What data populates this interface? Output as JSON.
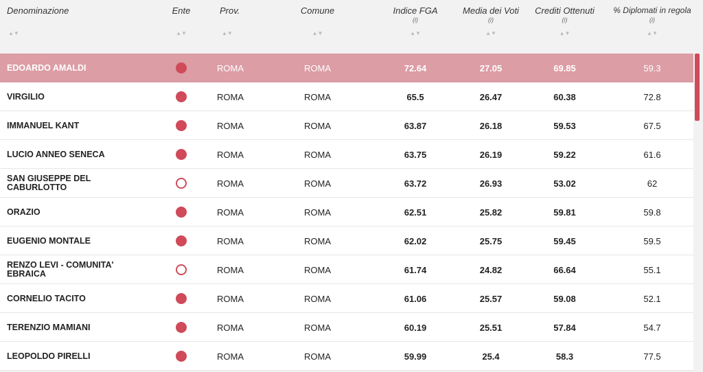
{
  "columns": {
    "denominazione": "Denominazione",
    "ente": "Ente",
    "prov": "Prov.",
    "comune": "Comune",
    "fga": "Indice FGA",
    "media": "Media dei Voti",
    "crediti": "Crediti Ottenuti",
    "diplomati": "% Diplomati in regola",
    "info_marker": "(i)",
    "sort_up": "▲",
    "sort_down": "▼"
  },
  "colors": {
    "accent": "#d04a59",
    "selected_row": "#dc9da5"
  },
  "rows": [
    {
      "name": "EDOARDO AMALDI",
      "ente": "filled",
      "prov": "ROMA",
      "comune": "ROMA",
      "fga": "72.64",
      "media": "27.05",
      "crediti": "69.85",
      "diplomati": "59.3",
      "selected": true
    },
    {
      "name": "VIRGILIO",
      "ente": "filled",
      "prov": "ROMA",
      "comune": "ROMA",
      "fga": "65.5",
      "media": "26.47",
      "crediti": "60.38",
      "diplomati": "72.8"
    },
    {
      "name": "IMMANUEL KANT",
      "ente": "filled",
      "prov": "ROMA",
      "comune": "ROMA",
      "fga": "63.87",
      "media": "26.18",
      "crediti": "59.53",
      "diplomati": "67.5"
    },
    {
      "name": "LUCIO ANNEO SENECA",
      "ente": "filled",
      "prov": "ROMA",
      "comune": "ROMA",
      "fga": "63.75",
      "media": "26.19",
      "crediti": "59.22",
      "diplomati": "61.6"
    },
    {
      "name": "SAN GIUSEPPE DEL CABURLOTTO",
      "ente": "empty",
      "prov": "ROMA",
      "comune": "ROMA",
      "fga": "63.72",
      "media": "26.93",
      "crediti": "53.02",
      "diplomati": "62"
    },
    {
      "name": "ORAZIO",
      "ente": "filled",
      "prov": "ROMA",
      "comune": "ROMA",
      "fga": "62.51",
      "media": "25.82",
      "crediti": "59.81",
      "diplomati": "59.8"
    },
    {
      "name": "EUGENIO MONTALE",
      "ente": "filled",
      "prov": "ROMA",
      "comune": "ROMA",
      "fga": "62.02",
      "media": "25.75",
      "crediti": "59.45",
      "diplomati": "59.5"
    },
    {
      "name": "RENZO LEVI - COMUNITA' EBRAICA",
      "ente": "empty",
      "prov": "ROMA",
      "comune": "ROMA",
      "fga": "61.74",
      "media": "24.82",
      "crediti": "66.64",
      "diplomati": "55.1"
    },
    {
      "name": "CORNELIO TACITO",
      "ente": "filled",
      "prov": "ROMA",
      "comune": "ROMA",
      "fga": "61.06",
      "media": "25.57",
      "crediti": "59.08",
      "diplomati": "52.1"
    },
    {
      "name": "TERENZIO MAMIANI",
      "ente": "filled",
      "prov": "ROMA",
      "comune": "ROMA",
      "fga": "60.19",
      "media": "25.51",
      "crediti": "57.84",
      "diplomati": "54.7"
    },
    {
      "name": "LEOPOLDO PIRELLI",
      "ente": "filled",
      "prov": "ROMA",
      "comune": "ROMA",
      "fga": "59.99",
      "media": "25.4",
      "crediti": "58.3",
      "diplomati": "77.5"
    }
  ]
}
